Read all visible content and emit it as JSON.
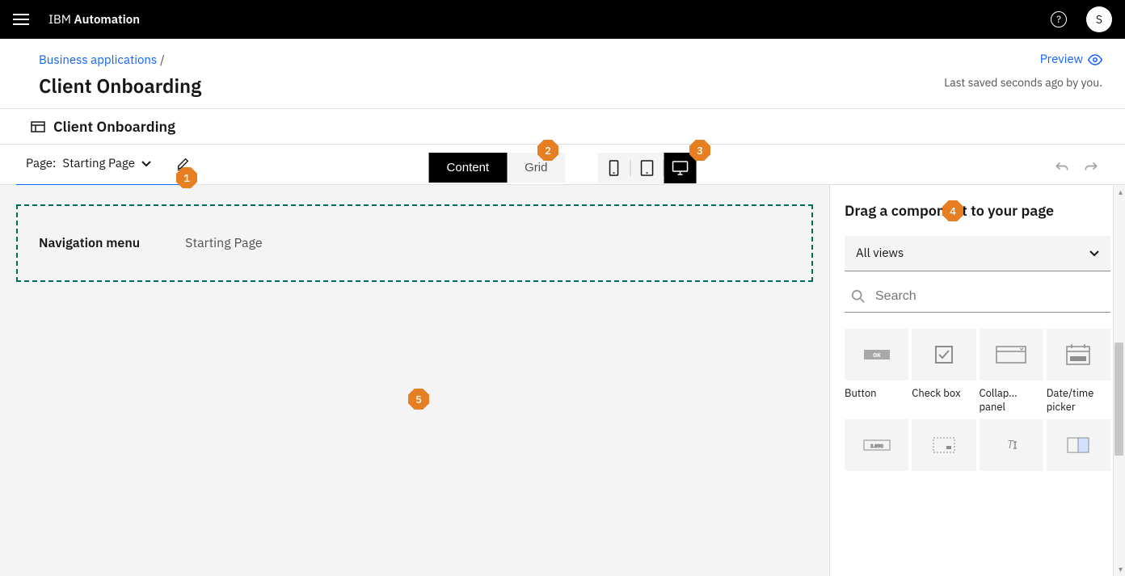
{
  "header": {
    "logo_prefix": "IBM ",
    "logo_bold": "Automation",
    "avatar_initial": "S"
  },
  "breadcrumb": {
    "link": "Business applications",
    "separator": "/"
  },
  "page": {
    "title": "Client Onboarding",
    "preview": "Preview",
    "saved_status": "Last saved seconds ago by you.",
    "sub_title": "Client Onboarding"
  },
  "toolbar": {
    "page_label": "Page:",
    "page_name": "Starting Page",
    "toggle_content": "Content",
    "toggle_grid": "Grid"
  },
  "canvas": {
    "nav_label": "Navigation menu",
    "nav_page": "Starting Page"
  },
  "panel": {
    "title": "Drag a component to your page",
    "dropdown": "All views",
    "search_placeholder": "Search",
    "components": [
      {
        "label": "Button"
      },
      {
        "label": "Check box"
      },
      {
        "label": "Collap... panel"
      },
      {
        "label": "Date/time picker"
      }
    ]
  },
  "markers": [
    "1",
    "2",
    "3",
    "4",
    "5"
  ]
}
